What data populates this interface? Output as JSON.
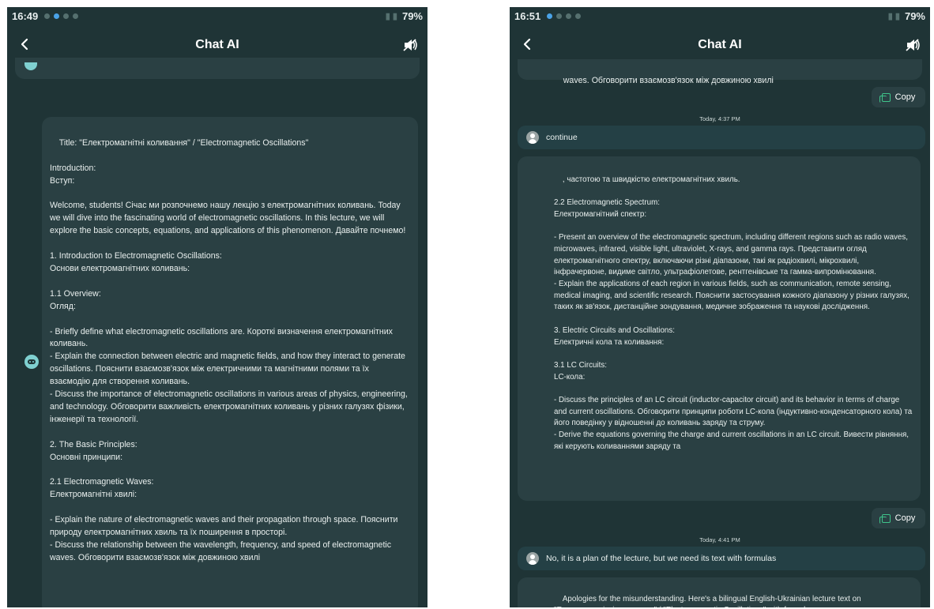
{
  "left": {
    "status": {
      "time": "16:49",
      "battery": "79%"
    },
    "header": {
      "title": "Chat AI"
    },
    "message": "Title: \"Електромагнітні коливання\" / \"Electromagnetic Oscillations\"\n\nIntroduction:\nВступ:\n\nWelcome, students! Січас ми розпочнемо нашу лекцію з електромагнітних коливань. Today we will dive into the fascinating world of electromagnetic oscillations. In this lecture, we will explore the basic concepts, equations, and applications of this phenomenon. Давайте почнемо!\n\n1. Introduction to Electromagnetic Oscillations:\nОснови електромагнітних коливань:\n\n1.1 Overview:\nОгляд:\n\n- Briefly define what electromagnetic oscillations are. Короткі визначення електромагнітних коливань.\n- Explain the connection between electric and magnetic fields, and how they interact to generate oscillations. Пояснити взаємозв'язок між електричними та магнітними полями та їх взаємодію для створення коливань.\n- Discuss the importance of electromagnetic oscillations in various areas of physics, engineering, and technology. Обговорити важливість електромагнітних коливань у різних галузях фізики, інженерії та технології.\n\n2. The Basic Principles:\nОсновні принципи:\n\n2.1 Electromagnetic Waves:\nЕлектромагнітні хвилі:\n\n- Explain the nature of electromagnetic waves and their propagation through space. Пояснити природу електромагнітних хвиль та їх поширення в просторі.\n- Discuss the relationship between the wavelength, frequency, and speed of electromagnetic waves. Обговорити взаємозв'язок між довжиною хвилі"
  },
  "right": {
    "status": {
      "time": "16:51",
      "battery": "79%"
    },
    "header": {
      "title": "Chat AI"
    },
    "top_fragment": "waves. Обговорити взаємозв'язок між довжиною хвилі",
    "copy_label": "Copy",
    "timestamp1": "Today, 4:37 PM",
    "user_msg1": "continue",
    "message": ", частотою та швидкістю електромагнітних хвиль.\n\n2.2 Electromagnetic Spectrum:\nЕлектромагнітний спектр:\n\n- Present an overview of the electromagnetic spectrum, including different regions such as radio waves, microwaves, infrared, visible light, ultraviolet, X-rays, and gamma rays. Представити огляд електромагнітного спектру, включаючи різні діапазони, такі як радіохвилі, мікрохвилі, інфрачервоне, видиме світло, ультрафіолетове, рентгенівське та гамма-випромінювання.\n- Explain the applications of each region in various fields, such as communication, remote sensing, medical imaging, and scientific research. Пояснити застосування кожного діапазону у різних галузях, таких як зв'язок, дистанційне зондування, медичне зображення та наукові дослідження.\n\n3. Electric Circuits and Oscillations:\nЕлектричні кола та коливання:\n\n3.1 LC Circuits:\nLC-кола:\n\n- Discuss the principles of an LC circuit (inductor-capacitor circuit) and its behavior in terms of charge and current oscillations. Обговорити принципи роботи LC-кола (індуктивно-конденсаторного кола) та його поведінку у відношенні до коливань заряду та струму.\n- Derive the equations governing the charge and current oscillations in an LC circuit. Вивести рівняння, які керують коливаннями заряду та",
    "timestamp2": "Today, 4:41 PM",
    "user_msg2": "No, it is a plan of the lecture, but we  need its text with formulas",
    "bottom_message": "Apologies for the misunderstanding. Here's a bilingual English-Ukrainian lecture text on \"Електромагнітні коливання\" / \"Electromagnetic Oscillations\" with formulas:"
  },
  "icons": {
    "back": "chevron-left-icon",
    "speaker": "speaker-muted-icon",
    "copy": "copy-icon",
    "bot": "bot-avatar-icon",
    "user": "user-avatar-icon"
  },
  "colors": {
    "background": "#1f3436",
    "bubble": "#2a4043",
    "accent": "#3fc48b",
    "avatar": "#7fd0d0"
  }
}
